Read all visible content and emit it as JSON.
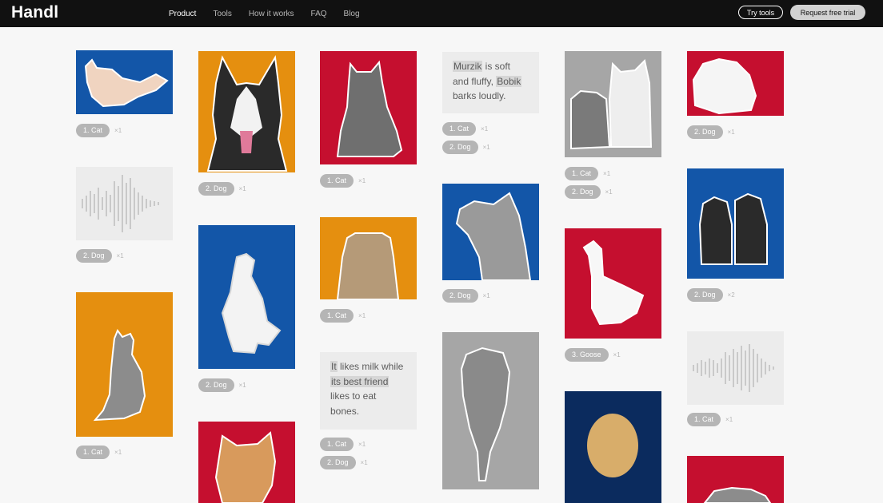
{
  "nav": {
    "logo": "Handl",
    "links": [
      "Product",
      "Tools",
      "How it works",
      "FAQ",
      "Blog"
    ],
    "try_tools": "Try tools",
    "request_trial": "Request free trial"
  },
  "labels": {
    "cat": "1. Cat",
    "dog": "2. Dog",
    "goose": "3. Goose",
    "x1": "×1",
    "x2": "×2"
  },
  "texts": {
    "t1": {
      "w1": "Murzik",
      "m1": " is soft and fluffy, ",
      "w2": "Bobik",
      "m2": " barks loudly."
    },
    "t2": {
      "w1": "It",
      "m1": " likes milk while ",
      "w2": "its best friend",
      "m2": " likes to eat bones."
    }
  },
  "colors": {
    "orange": "#e58f0f",
    "red": "#c50f2f",
    "blue": "#1356a8",
    "gray": "#a6a6a6",
    "navy": "#0b2b5e"
  }
}
